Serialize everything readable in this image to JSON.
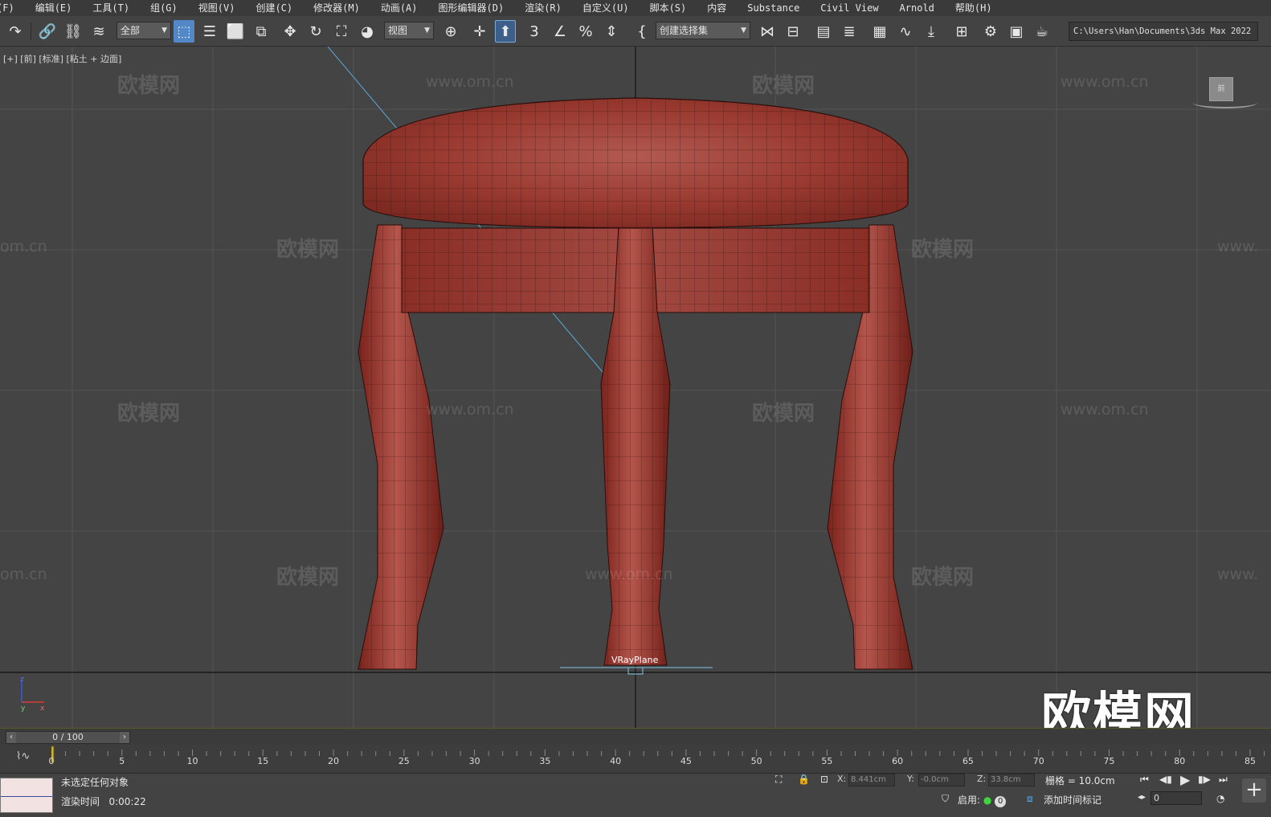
{
  "menu": [
    "(F)",
    "编辑(E)",
    "工具(T)",
    "组(G)",
    "视图(V)",
    "创建(C)",
    "修改器(M)",
    "动画(A)",
    "图形编辑器(D)",
    "渲染(R)",
    "自定义(U)",
    "脚本(S)",
    "内容",
    "Substance",
    "Civil View",
    "Arnold",
    "帮助(H)"
  ],
  "toolbar": {
    "filter_value": "全部",
    "coord_system": "视图",
    "named_selection": "创建选择集",
    "project_path": "C:\\Users\\Han\\Documents\\3ds Max 2022",
    "snap_value": "3"
  },
  "viewport": {
    "label": "[+] [前] [标准] [粘土 + 边面]",
    "object_label": "VRayPlane",
    "viewcube_text": "前",
    "watermark_cn": "欧模网",
    "watermark_url": "www.om.cn",
    "watermark_url_partial": "om.cn",
    "watermark_url_prefix": "www.",
    "brand": "欧模网",
    "axis": {
      "z": "z",
      "x": "x",
      "y": "y"
    }
  },
  "timeline": {
    "slider": "0 / 100",
    "ticks": [
      "0",
      "5",
      "10",
      "15",
      "20",
      "25",
      "30",
      "35",
      "40",
      "45",
      "50",
      "55",
      "60",
      "65",
      "70",
      "75",
      "80",
      "85"
    ]
  },
  "status": {
    "selection": "未选定任何对象",
    "render_time_label": "渲染时间",
    "render_time": "0:00:22",
    "x_label": "X:",
    "x_value": "8.441cm",
    "y_label": "Y:",
    "y_value": "-0.0cm",
    "z_label": "Z:",
    "z_value": "33.8cm",
    "grid": "栅格 = 10.0cm",
    "enable": "启用:",
    "enable_count": "0",
    "add_time_tag": "添加时间标记",
    "frame": "0"
  },
  "colors": {
    "viewport_bg": "#444444",
    "model_red": "#a33a30",
    "active_button": "#5287c8"
  }
}
